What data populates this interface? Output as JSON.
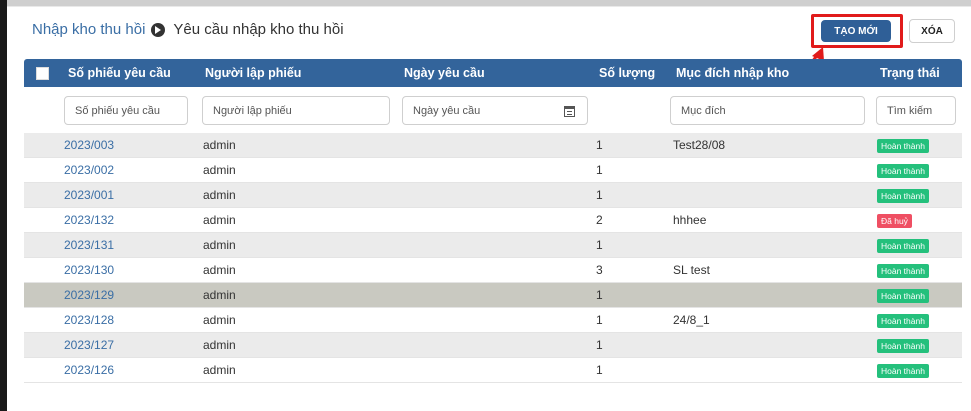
{
  "breadcrumb": {
    "parent": "Nhập kho thu hồi",
    "current": "Yêu cầu nhập kho thu hồi",
    "separator_icon": "arrow-circle-right-icon"
  },
  "toolbar": {
    "create_label": "TẠO MỚI",
    "delete_label": "XÓA",
    "create_color": "#2f5f97",
    "highlight_color": "#e11b1b"
  },
  "table": {
    "header_color": "#33649b",
    "columns": {
      "code": "Số phiếu yêu cầu",
      "creator": "Người lập phiếu",
      "date": "Ngày yêu cầu",
      "qty": "Số lượng",
      "purpose": "Mục đích nhập kho",
      "status": "Trạng thái"
    },
    "filters": {
      "code": "Số phiếu yêu cầu",
      "creator": "Người lập phiếu",
      "date": "Ngày yêu cầu",
      "purpose": "Mục đích",
      "status": "Tìm kiếm"
    },
    "rows": [
      {
        "code": "2023/003",
        "creator": "admin",
        "qty": "1",
        "purpose": "Test28/08",
        "status": "Hoàn thành",
        "status_type": "done"
      },
      {
        "code": "2023/002",
        "creator": "admin",
        "qty": "1",
        "purpose": "",
        "status": "Hoàn thành",
        "status_type": "done"
      },
      {
        "code": "2023/001",
        "creator": "admin",
        "qty": "1",
        "purpose": "",
        "status": "Hoàn thành",
        "status_type": "done"
      },
      {
        "code": "2023/132",
        "creator": "admin",
        "qty": "2",
        "purpose": "hhhee",
        "status": "Đã huỷ",
        "status_type": "cancel"
      },
      {
        "code": "2023/131",
        "creator": "admin",
        "qty": "1",
        "purpose": "",
        "status": "Hoàn thành",
        "status_type": "done"
      },
      {
        "code": "2023/130",
        "creator": "admin",
        "qty": "3",
        "purpose": "SL test",
        "status": "Hoàn thành",
        "status_type": "done"
      },
      {
        "code": "2023/129",
        "creator": "admin",
        "qty": "1",
        "purpose": "",
        "status": "Hoàn thành",
        "status_type": "done",
        "selected": true
      },
      {
        "code": "2023/128",
        "creator": "admin",
        "qty": "1",
        "purpose": "24/8_1",
        "status": "Hoàn thành",
        "status_type": "done"
      },
      {
        "code": "2023/127",
        "creator": "admin",
        "qty": "1",
        "purpose": "",
        "status": "Hoàn thành",
        "status_type": "done"
      },
      {
        "code": "2023/126",
        "creator": "admin",
        "qty": "1",
        "purpose": "",
        "status": "Hoàn thành",
        "status_type": "done"
      }
    ]
  },
  "status_colors": {
    "done": "#24c07c",
    "cancel": "#ef4f63"
  }
}
